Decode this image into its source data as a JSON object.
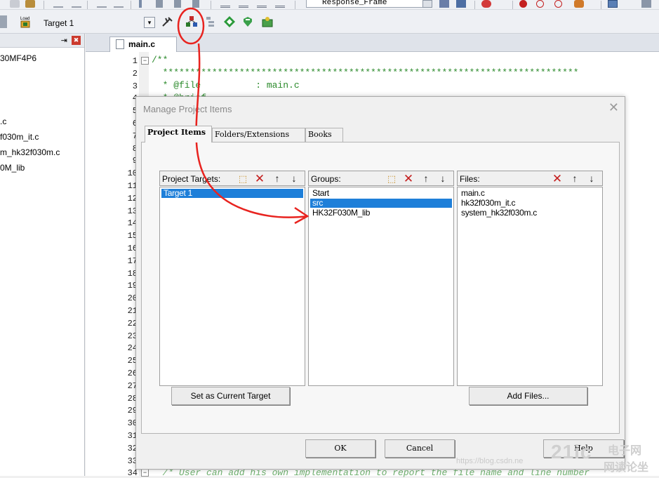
{
  "toolbar_top": {
    "combo_text": "Response_Frame"
  },
  "toolbar_main": {
    "load_label": "Load",
    "target_value": "Target 1"
  },
  "project_panel": {
    "pin_glyph": "⇥",
    "close_glyph": "✖",
    "items": [
      "30MF4P6",
      ".c",
      "f030m_it.c",
      "m_hk32f030m.c",
      "0M_lib"
    ]
  },
  "editor": {
    "tab_label": "main.c",
    "line_numbers": [
      "1",
      "2",
      "3",
      "4",
      "5",
      "6",
      "7",
      "8",
      "9",
      "10",
      "11",
      "12",
      "13",
      "14",
      "15",
      "16",
      "17",
      "18",
      "19",
      "20",
      "21",
      "22",
      "23",
      "24",
      "25",
      "26",
      "27",
      "28",
      "29",
      "30",
      "31",
      "32",
      "33",
      "34"
    ],
    "code_lines": [
      "/**",
      "  ****************************************************************************",
      "  * @file          : main.c",
      "  * @brief",
      "  ****************************************************************************",
      "",
      "",
      "",
      "",
      "  --------------------------------------------------------------------------*/",
      "  /* User can add his own implementation to report the file name and line number"
    ]
  },
  "dialog": {
    "title": "Manage Project Items",
    "close_glyph": "✕",
    "tabs": [
      "Project Items",
      "Folders/Extensions",
      "Books"
    ],
    "targets": {
      "label": "Project Targets:",
      "items": [
        "Target 1"
      ],
      "selected": 0
    },
    "groups": {
      "label": "Groups:",
      "items": [
        "Start",
        "src",
        "HK32F030M_lib"
      ],
      "selected": 1
    },
    "files": {
      "label": "Files:",
      "items": [
        "main.c",
        "hk32f030m_it.c",
        "system_hk32f030m.c"
      ]
    },
    "buttons": {
      "set_current": "Set as Current Target",
      "add_files": "Add Files...",
      "ok": "OK",
      "cancel": "Cancel",
      "help": "Help"
    },
    "list_button_glyphs": {
      "new": "⬚",
      "delete": "✕",
      "up": "↑",
      "down": "↓"
    }
  },
  "annotation_color": "#e8231f",
  "watermark": {
    "url": "https://blog.csdn.ne",
    "brand": "21ic",
    "cn1": "电子网",
    "cn2": "网读论坐"
  }
}
